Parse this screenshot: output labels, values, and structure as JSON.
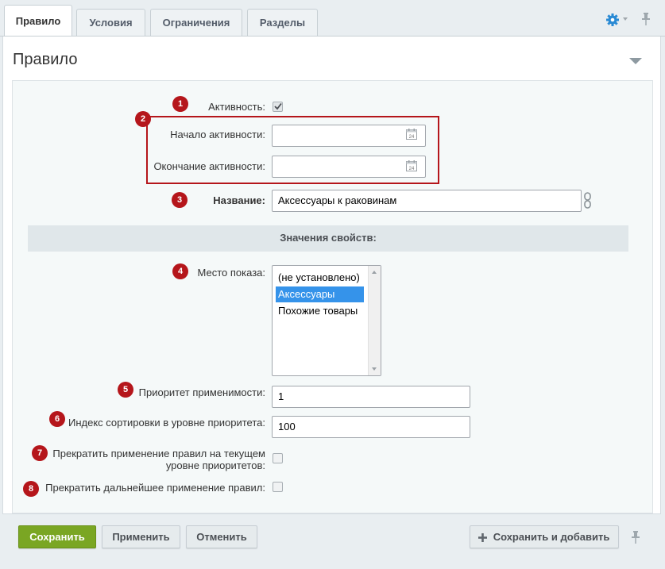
{
  "tabs": [
    {
      "label": "Правило",
      "active": true
    },
    {
      "label": "Условия",
      "active": false
    },
    {
      "label": "Ограничения",
      "active": false
    },
    {
      "label": "Разделы",
      "active": false
    }
  ],
  "header": {
    "title": "Правило"
  },
  "form": {
    "active": {
      "label": "Активность:",
      "checked": true
    },
    "start": {
      "label": "Начало активности:",
      "value": "",
      "calendar_day": "24"
    },
    "end": {
      "label": "Окончание активности:",
      "value": "",
      "calendar_day": "24"
    },
    "name": {
      "label": "Название:",
      "value": "Аксессуары к раковинам"
    },
    "section_title": "Значения свойств:",
    "place": {
      "label": "Место показа:",
      "options": [
        "(не установлено)",
        "Аксессуары",
        "Похожие товары"
      ],
      "selected": "Аксессуары"
    },
    "priority": {
      "label": "Приоритет применимости:",
      "value": "1"
    },
    "sort": {
      "label": "Индекс сортировки в уровне приоритета:",
      "value": "100"
    },
    "stop_level": {
      "label_line1": "Прекратить применение правил на текущем",
      "label_line2": "уровне приоритетов:",
      "checked": false
    },
    "stop_all": {
      "label": "Прекратить дальнейшее применение правил:",
      "checked": false
    }
  },
  "badges": [
    "1",
    "2",
    "3",
    "4",
    "5",
    "6",
    "7",
    "8"
  ],
  "buttons": {
    "save": "Сохранить",
    "apply": "Применить",
    "cancel": "Отменить",
    "save_add": "Сохранить и добавить"
  },
  "colors": {
    "accent_green": "#7aa623",
    "badge_red": "#b5161b",
    "selection_blue": "#3593ea",
    "gear_blue": "#2a8ad4"
  },
  "icons": [
    "gear-icon",
    "pin-icon",
    "calendar-icon",
    "link-icon",
    "plus-icon",
    "checkmark-icon"
  ]
}
